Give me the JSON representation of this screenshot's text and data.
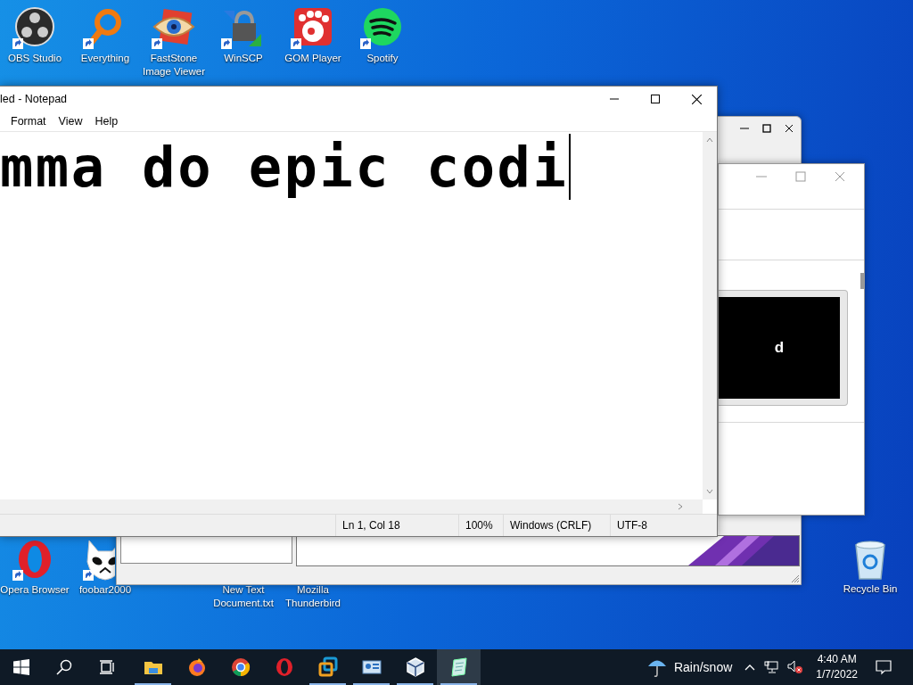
{
  "desktop_icons": [
    {
      "label": "OBS Studio",
      "kind": "obs"
    },
    {
      "label": "Everything",
      "kind": "everything"
    },
    {
      "label": "FastStone Image Viewer",
      "kind": "faststone"
    },
    {
      "label": "WinSCP",
      "kind": "winscp"
    },
    {
      "label": "GOM Player",
      "kind": "gom"
    },
    {
      "label": "Spotify",
      "kind": "spotify"
    },
    {
      "label": "Opera Browser",
      "kind": "opera"
    },
    {
      "label": "foobar2000",
      "kind": "foobar"
    },
    {
      "label": "New Text Document.txt",
      "kind": "covered"
    },
    {
      "label": "Mozilla Thunderbird",
      "kind": "covered"
    },
    {
      "label": "Recycle Bin",
      "kind": "recycle"
    }
  ],
  "preview_window": {
    "preview_text": "d"
  },
  "notepad": {
    "title": "led - Notepad",
    "menu": [
      "Format",
      "View",
      "Help"
    ],
    "text": "mma do epic codi",
    "status_bar": [
      "Ln 1, Col 18",
      "100%",
      "Windows (CRLF)",
      "UTF-8"
    ]
  },
  "taskbar": {
    "apps": [
      {
        "kind": "explorer",
        "running": true,
        "selected": false
      },
      {
        "kind": "firefox",
        "running": false,
        "selected": false
      },
      {
        "kind": "chrome",
        "running": false,
        "selected": false
      },
      {
        "kind": "opera",
        "running": false,
        "selected": false
      },
      {
        "kind": "vmware",
        "running": true,
        "selected": false
      },
      {
        "kind": "remote",
        "running": true,
        "selected": false
      },
      {
        "kind": "virtualbox",
        "running": true,
        "selected": false
      },
      {
        "kind": "notepad",
        "running": true,
        "selected": true
      }
    ],
    "weather": "Rain/snow",
    "time": "4:40 AM",
    "date": "1/7/2022"
  }
}
